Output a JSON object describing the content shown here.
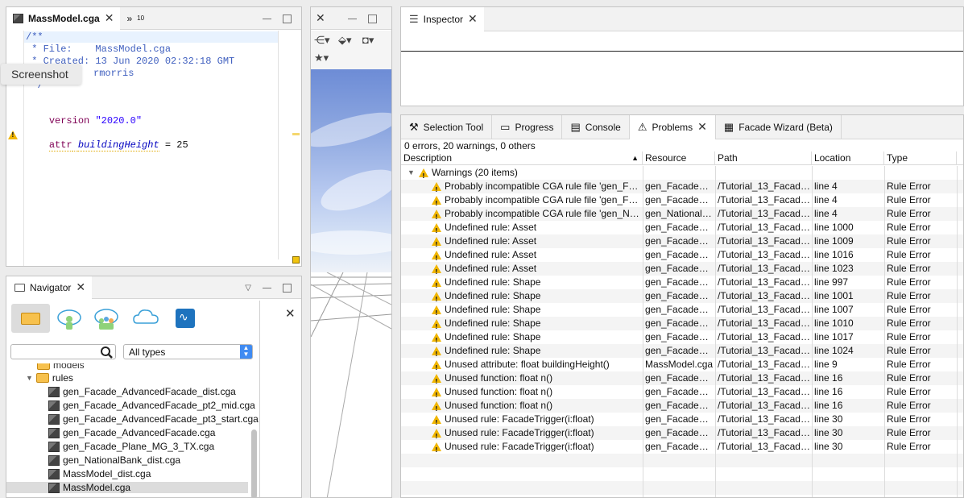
{
  "editor": {
    "tab_label": "MassModel.cga",
    "overflow_label": "»",
    "overflow_count": "10",
    "code": {
      "l1": "/**",
      "l2": " * File:    MassModel.cga",
      "l3": " * Created: 13 Jun 2020 02:32:18 GMT",
      "l4_tail": "rmorris",
      "l5": " */",
      "l6_kw": "version",
      "l6_str": "\"2020.0\"",
      "l7_kw": "attr",
      "l7_name": "buildingHeight",
      "l7_rest": " = 25"
    },
    "tooltip": "Screenshot"
  },
  "navigator": {
    "tab_label": "Navigator",
    "filter_select": "All types",
    "search_value": "",
    "tree": {
      "partial_item": "models",
      "folder": "rules",
      "files": [
        "gen_Facade_AdvancedFacade_dist.cga",
        "gen_Facade_AdvancedFacade_pt2_mid.cga",
        "gen_Facade_AdvancedFacade_pt3_start.cga",
        "gen_Facade_AdvancedFacade.cga",
        "gen_Facade_Plane_MG_3_TX.cga",
        "gen_NationalBank_dist.cga",
        "MassModel_dist.cga",
        "MassModel.cga"
      ],
      "selected_index": 7
    }
  },
  "inspector": {
    "tab_label": "Inspector"
  },
  "bottom_tabs": [
    {
      "label": "Selection Tool",
      "icon": "wrench-icon"
    },
    {
      "label": "Progress",
      "icon": "progress-icon"
    },
    {
      "label": "Console",
      "icon": "console-icon"
    },
    {
      "label": "Problems",
      "icon": "warning-icon"
    },
    {
      "label": "Facade Wizard (Beta)",
      "icon": "building-icon"
    }
  ],
  "problems": {
    "summary": "0 errors, 20 warnings, 0 others",
    "columns": [
      "Description",
      "Resource",
      "Path",
      "Location",
      "Type"
    ],
    "group_label": "Warnings (20 items)",
    "rows": [
      [
        "Probably incompatible CGA rule file 'gen_Fac…",
        "gen_Facade_A…",
        "/Tutorial_13_Facade…",
        "line 4",
        "Rule Error"
      ],
      [
        "Probably incompatible CGA rule file 'gen_Fac…",
        "gen_Facade_A…",
        "/Tutorial_13_Facade…",
        "line 4",
        "Rule Error"
      ],
      [
        "Probably incompatible CGA rule file 'gen_Nat…",
        "gen_NationalB…",
        "/Tutorial_13_Facade…",
        "line 4",
        "Rule Error"
      ],
      [
        "Undefined rule: Asset",
        "gen_Facade_A…",
        "/Tutorial_13_Facade…",
        "line 1000",
        "Rule Error"
      ],
      [
        "Undefined rule: Asset",
        "gen_Facade_A…",
        "/Tutorial_13_Facade…",
        "line 1009",
        "Rule Error"
      ],
      [
        "Undefined rule: Asset",
        "gen_Facade_A…",
        "/Tutorial_13_Facade…",
        "line 1016",
        "Rule Error"
      ],
      [
        "Undefined rule: Asset",
        "gen_Facade_A…",
        "/Tutorial_13_Facade…",
        "line 1023",
        "Rule Error"
      ],
      [
        "Undefined rule: Shape",
        "gen_Facade_A…",
        "/Tutorial_13_Facade…",
        "line 997",
        "Rule Error"
      ],
      [
        "Undefined rule: Shape",
        "gen_Facade_A…",
        "/Tutorial_13_Facade…",
        "line 1001",
        "Rule Error"
      ],
      [
        "Undefined rule: Shape",
        "gen_Facade_A…",
        "/Tutorial_13_Facade…",
        "line 1007",
        "Rule Error"
      ],
      [
        "Undefined rule: Shape",
        "gen_Facade_A…",
        "/Tutorial_13_Facade…",
        "line 1010",
        "Rule Error"
      ],
      [
        "Undefined rule: Shape",
        "gen_Facade_A…",
        "/Tutorial_13_Facade…",
        "line 1017",
        "Rule Error"
      ],
      [
        "Undefined rule: Shape",
        "gen_Facade_A…",
        "/Tutorial_13_Facade…",
        "line 1024",
        "Rule Error"
      ],
      [
        "Unused attribute: float buildingHeight()",
        "MassModel.cga",
        "/Tutorial_13_Facade…",
        "line 9",
        "Rule Error"
      ],
      [
        "Unused function: float n()",
        "gen_Facade_A…",
        "/Tutorial_13_Facade…",
        "line 16",
        "Rule Error"
      ],
      [
        "Unused function: float n()",
        "gen_Facade_A…",
        "/Tutorial_13_Facade…",
        "line 16",
        "Rule Error"
      ],
      [
        "Unused function: float n()",
        "gen_Facade_A…",
        "/Tutorial_13_Facade…",
        "line 16",
        "Rule Error"
      ],
      [
        "Unused rule: FacadeTrigger(i:float)",
        "gen_Facade_A…",
        "/Tutorial_13_Facade…",
        "line 30",
        "Rule Error"
      ],
      [
        "Unused rule: FacadeTrigger(i:float)",
        "gen_Facade_A…",
        "/Tutorial_13_Facade…",
        "line 30",
        "Rule Error"
      ],
      [
        "Unused rule: FacadeTrigger(i:float)",
        "gen_Facade_A…",
        "/Tutorial_13_Facade…",
        "line 30",
        "Rule Error"
      ]
    ]
  }
}
